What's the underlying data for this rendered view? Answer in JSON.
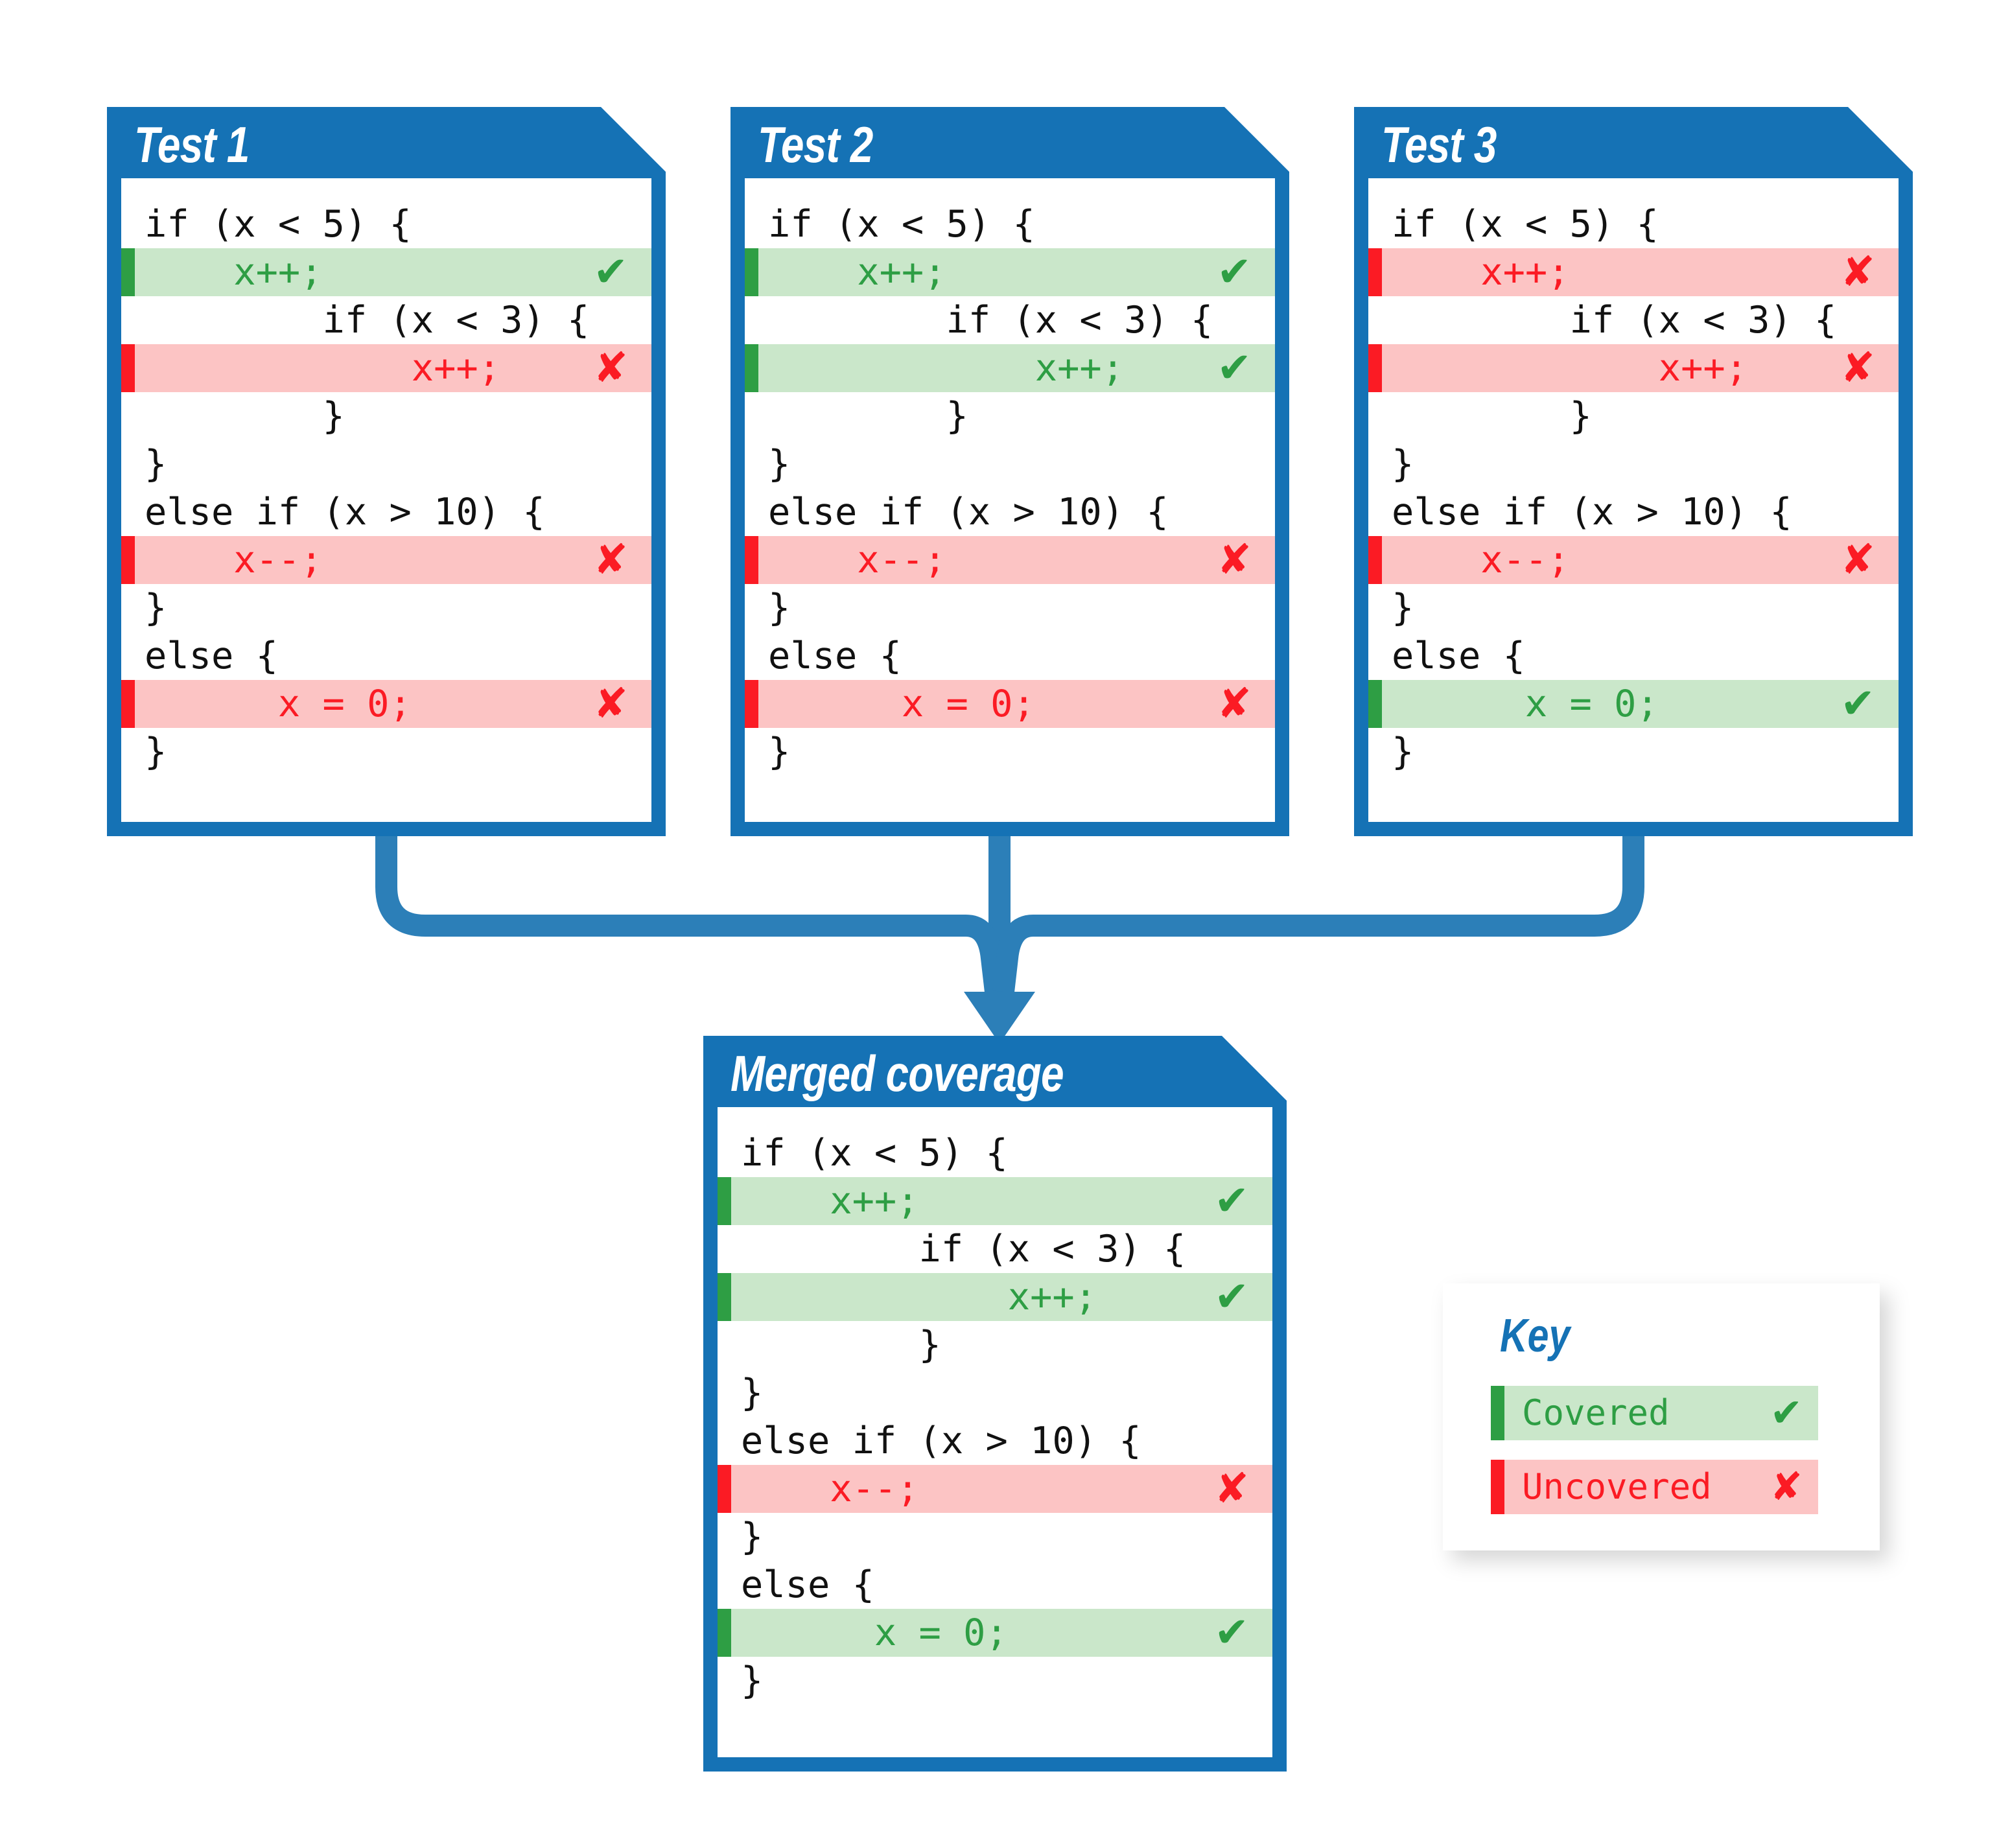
{
  "palette": {
    "blue": "#1572b5",
    "green_bar": "#2e9e44",
    "green_bg": "#cae7ca",
    "red_bar": "#fb1b24",
    "red_bg": "#fcc4c4",
    "page_bg": "#ffffff"
  },
  "icons": {
    "check": "✔",
    "cross": "✘"
  },
  "cards": [
    {
      "id": "test-1",
      "title": "Test 1",
      "lines": [
        {
          "text": "if (x < 5) {",
          "state": "plain"
        },
        {
          "text": "    x++;",
          "state": "covered"
        },
        {
          "text": "        if (x < 3) {",
          "state": "plain"
        },
        {
          "text": "            x++;",
          "state": "uncovered"
        },
        {
          "text": "        }",
          "state": "plain"
        },
        {
          "text": "}",
          "state": "plain"
        },
        {
          "text": "else if (x > 10) {",
          "state": "plain"
        },
        {
          "text": "    x--;",
          "state": "uncovered"
        },
        {
          "text": "}",
          "state": "plain"
        },
        {
          "text": "else {",
          "state": "plain"
        },
        {
          "text": "      x = 0;",
          "state": "uncovered"
        },
        {
          "text": "}",
          "state": "plain"
        }
      ]
    },
    {
      "id": "test-2",
      "title": "Test 2",
      "lines": [
        {
          "text": "if (x < 5) {",
          "state": "plain"
        },
        {
          "text": "    x++;",
          "state": "covered"
        },
        {
          "text": "        if (x < 3) {",
          "state": "plain"
        },
        {
          "text": "            x++;",
          "state": "covered"
        },
        {
          "text": "        }",
          "state": "plain"
        },
        {
          "text": "}",
          "state": "plain"
        },
        {
          "text": "else if (x > 10) {",
          "state": "plain"
        },
        {
          "text": "    x--;",
          "state": "uncovered"
        },
        {
          "text": "}",
          "state": "plain"
        },
        {
          "text": "else {",
          "state": "plain"
        },
        {
          "text": "      x = 0;",
          "state": "uncovered"
        },
        {
          "text": "}",
          "state": "plain"
        }
      ]
    },
    {
      "id": "test-3",
      "title": "Test 3",
      "lines": [
        {
          "text": "if (x < 5) {",
          "state": "plain"
        },
        {
          "text": "    x++;",
          "state": "uncovered"
        },
        {
          "text": "        if (x < 3) {",
          "state": "plain"
        },
        {
          "text": "            x++;",
          "state": "uncovered"
        },
        {
          "text": "        }",
          "state": "plain"
        },
        {
          "text": "}",
          "state": "plain"
        },
        {
          "text": "else if (x > 10) {",
          "state": "plain"
        },
        {
          "text": "    x--;",
          "state": "uncovered"
        },
        {
          "text": "}",
          "state": "plain"
        },
        {
          "text": "else {",
          "state": "plain"
        },
        {
          "text": "      x = 0;",
          "state": "covered"
        },
        {
          "text": "}",
          "state": "plain"
        }
      ]
    }
  ],
  "merged": {
    "id": "merged-coverage",
    "title": "Merged coverage",
    "lines": [
      {
        "text": "if (x < 5) {",
        "state": "plain"
      },
      {
        "text": "    x++;",
        "state": "covered"
      },
      {
        "text": "        if (x < 3) {",
        "state": "plain"
      },
      {
        "text": "            x++;",
        "state": "covered"
      },
      {
        "text": "        }",
        "state": "plain"
      },
      {
        "text": "}",
        "state": "plain"
      },
      {
        "text": "else if (x > 10) {",
        "state": "plain"
      },
      {
        "text": "    x--;",
        "state": "uncovered"
      },
      {
        "text": "}",
        "state": "plain"
      },
      {
        "text": "else {",
        "state": "plain"
      },
      {
        "text": "      x = 0;",
        "state": "covered"
      },
      {
        "text": "}",
        "state": "plain"
      }
    ]
  },
  "key": {
    "title": "Key",
    "rows": [
      {
        "label": "Covered",
        "state": "covered"
      },
      {
        "label": "Uncovered",
        "state": "uncovered"
      }
    ]
  }
}
